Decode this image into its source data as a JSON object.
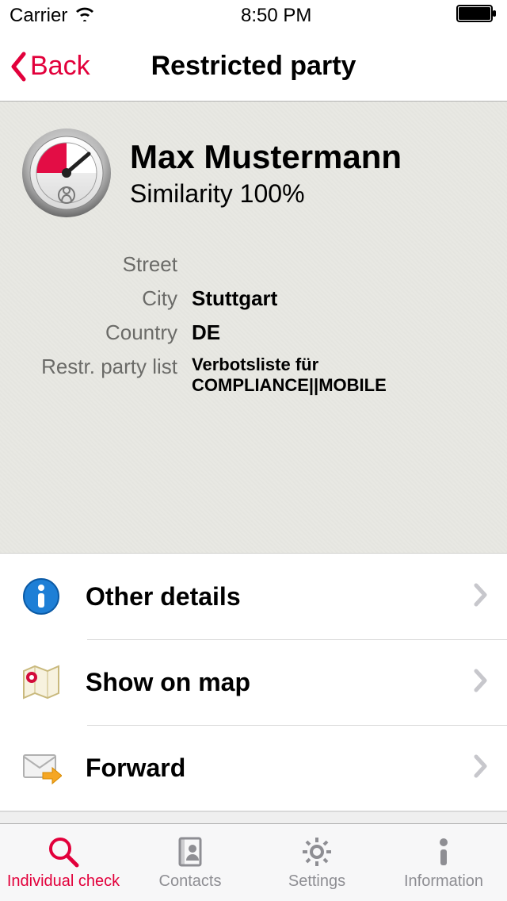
{
  "status": {
    "carrier": "Carrier",
    "time": "8:50 PM"
  },
  "nav": {
    "back": "Back",
    "title": "Restricted party"
  },
  "party": {
    "name": "Max Mustermann",
    "similarity": "Similarity 100%",
    "fields": {
      "street_label": "Street",
      "street_value": "",
      "city_label": "City",
      "city_value": "Stuttgart",
      "country_label": "Country",
      "country_value": "DE",
      "list_label": "Restr. party list",
      "list_value": "Verbotsliste für COMPLIANCE||MOBILE"
    }
  },
  "actions": {
    "details": "Other details",
    "map": "Show on map",
    "forward": "Forward"
  },
  "tabs": {
    "individual": "Individual check",
    "contacts": "Contacts",
    "settings": "Settings",
    "information": "Information"
  },
  "colors": {
    "accent": "#e2003b"
  }
}
